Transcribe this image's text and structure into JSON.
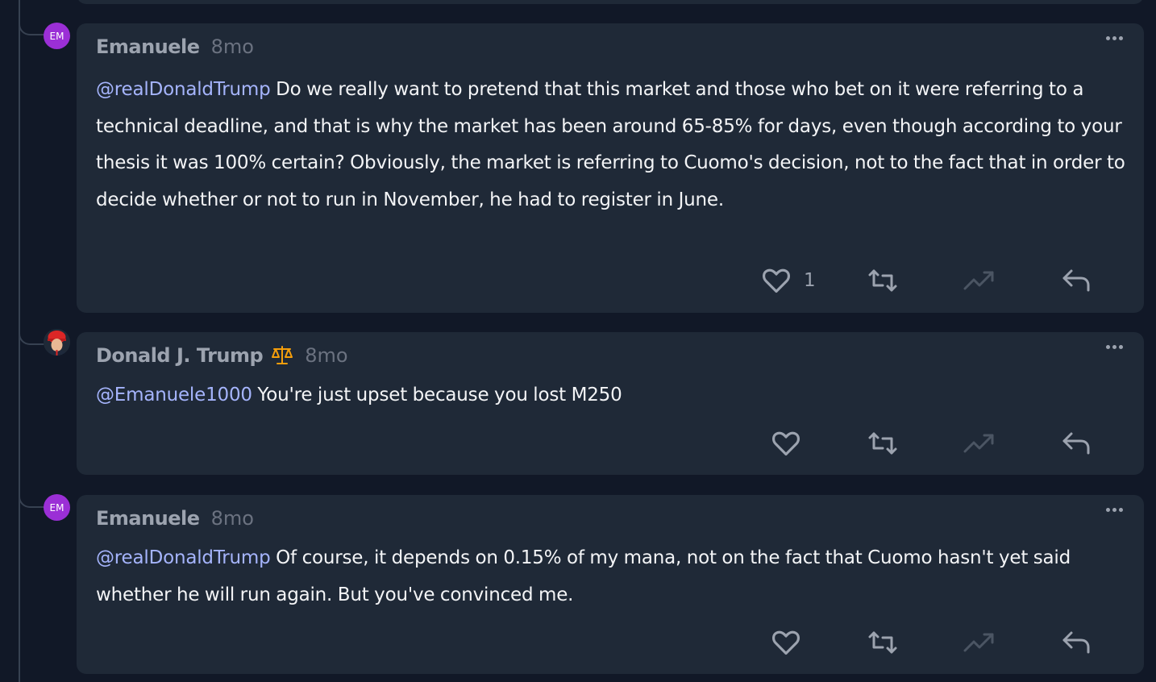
{
  "comments": [
    {
      "avatar_text": "EM",
      "author": "Emanuele",
      "time": "8mo",
      "mention": "@realDonaldTrump",
      "text": " Do we really want to pretend that this market and those who bet on it were referring to a technical deadline, and that is why the market has been around 65-85% for days, even though according to your thesis it was 100% certain? Obviously, the market is referring to Cuomo's decision, not to the fact that in order to decide whether or not to run in November, he had to register in June.",
      "like_count": "1"
    },
    {
      "avatar_text": "",
      "author": "Donald J. Trump",
      "time": "8mo",
      "mention": "@Emanuele1000",
      "text": " You're just upset because you lost M250",
      "like_count": ""
    },
    {
      "avatar_text": "EM",
      "author": "Emanuele",
      "time": "8mo",
      "mention": "@realDonaldTrump",
      "text": " Of course, it depends on 0.15% of my mana, not on the fact that Cuomo hasn't yet said whether he will run again. But you've convinced me.",
      "like_count": ""
    }
  ],
  "colors": {
    "page_bg": "#111827",
    "card_bg": "#1f2937",
    "mention": "#a5b4fc",
    "avatar_em": "#9b2fd6",
    "badge": "#f59e0b"
  },
  "icons": [
    "heart-icon",
    "repost-icon",
    "boost-icon",
    "reply-icon",
    "more-icon",
    "scales-badge-icon"
  ]
}
